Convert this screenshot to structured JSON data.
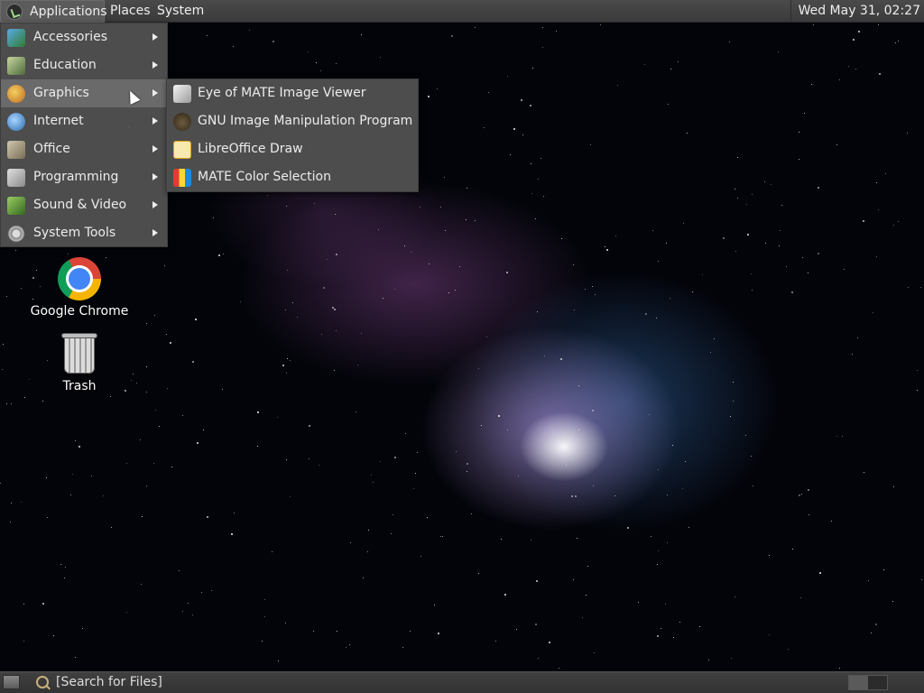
{
  "top_panel": {
    "menus": [
      {
        "label": "Applications"
      },
      {
        "label": "Places"
      },
      {
        "label": "System"
      }
    ],
    "clock": "Wed May 31, 02:27"
  },
  "applications_menu": {
    "items": [
      {
        "label": "Accessories",
        "icon": "accessories-icon",
        "has_submenu": true
      },
      {
        "label": "Education",
        "icon": "education-icon",
        "has_submenu": true
      },
      {
        "label": "Graphics",
        "icon": "graphics-icon",
        "has_submenu": true,
        "active": true
      },
      {
        "label": "Internet",
        "icon": "internet-icon",
        "has_submenu": true
      },
      {
        "label": "Office",
        "icon": "office-icon",
        "has_submenu": true
      },
      {
        "label": "Programming",
        "icon": "programming-icon",
        "has_submenu": true
      },
      {
        "label": "Sound & Video",
        "icon": "sound-video-icon",
        "has_submenu": true
      },
      {
        "label": "System Tools",
        "icon": "system-tools-icon",
        "has_submenu": true
      }
    ]
  },
  "graphics_submenu": {
    "items": [
      {
        "label": "Eye of MATE Image Viewer",
        "icon": "image-viewer-icon"
      },
      {
        "label": "GNU Image Manipulation Program",
        "icon": "gimp-icon"
      },
      {
        "label": "LibreOffice Draw",
        "icon": "libreoffice-draw-icon"
      },
      {
        "label": "MATE Color Selection",
        "icon": "color-selection-icon"
      }
    ]
  },
  "desktop": {
    "icons": [
      {
        "label": "Google Chrome",
        "icon": "chrome-icon"
      },
      {
        "label": "Trash",
        "icon": "trash-icon"
      }
    ]
  },
  "bottom_panel": {
    "search_label": "[Search for Files]"
  }
}
